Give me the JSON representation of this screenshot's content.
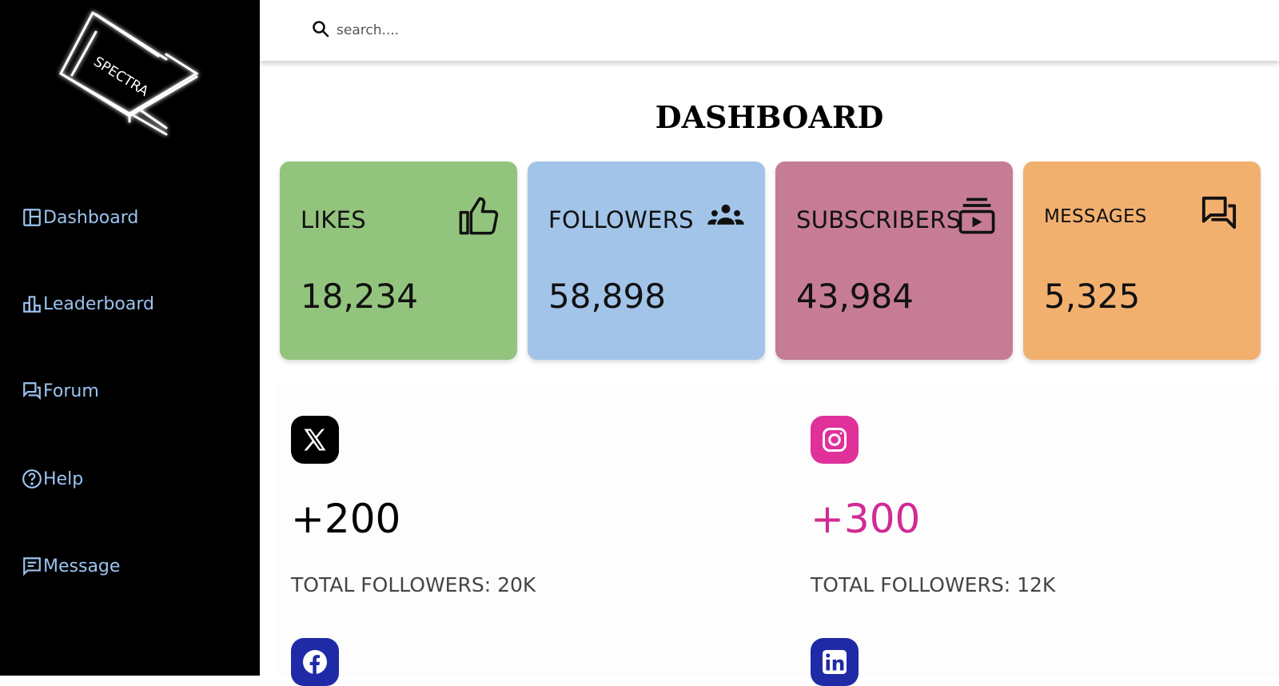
{
  "brand": {
    "logo_text": "SPECTRA"
  },
  "sidebar": {
    "items": [
      {
        "label": "Dashboard",
        "icon": "dashboard-icon"
      },
      {
        "label": "Leaderboard",
        "icon": "leaderboard-icon"
      },
      {
        "label": "Forum",
        "icon": "forum-icon"
      },
      {
        "label": "Help",
        "icon": "help-icon"
      },
      {
        "label": "Message",
        "icon": "message-icon"
      }
    ]
  },
  "search": {
    "placeholder": "search...."
  },
  "page": {
    "title": "DASHBOARD"
  },
  "stats": [
    {
      "label": "LIKES",
      "value": "18,234",
      "icon": "thumbs-up-icon",
      "color": "#93c47d"
    },
    {
      "label": "FOLLOWERS",
      "value": "58,898",
      "icon": "people-icon",
      "color": "#a2c4e9"
    },
    {
      "label": "SUBSCRIBERS",
      "value": "43,984",
      "icon": "subscriptions-icon",
      "color": "#c67c94"
    },
    {
      "label": "MESSAGES",
      "value": "5,325",
      "icon": "chat-icon",
      "color": "#f2b06f"
    }
  ],
  "social": [
    {
      "network_icon": "x-icon",
      "delta": "+200",
      "total": "TOTAL FOLLOWERS: 20K",
      "badge_color": "#000000",
      "delta_color": "#000000"
    },
    {
      "network_icon": "instagram-icon",
      "delta": "+300",
      "total": "TOTAL FOLLOWERS: 12K",
      "badge_color": "#e0309a",
      "delta_color": "#d12b94"
    },
    {
      "network_icon": "facebook-icon",
      "badge_color": "#1f2aa6"
    },
    {
      "network_icon": "linkedin-icon",
      "badge_color": "#1f2aa6"
    }
  ]
}
